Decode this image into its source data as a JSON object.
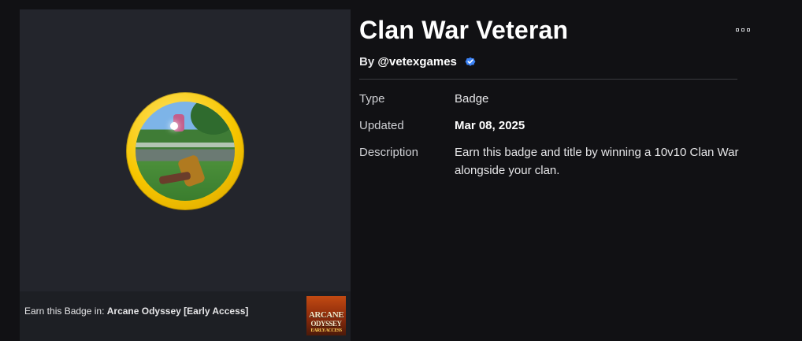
{
  "badge": {
    "title": "Clan War Veteran",
    "by_prefix": "By",
    "creator": "@vetexgames",
    "image_icon": "badge-artwork",
    "verified_icon": "verified-check-icon",
    "accent_color": "#f7c600",
    "verified_color": "#3b82f6"
  },
  "details": {
    "type_label": "Type",
    "type_value": "Badge",
    "updated_label": "Updated",
    "updated_value": "Mar 08, 2025",
    "description_label": "Description",
    "description_value": "Earn this badge and title by winning a 10v10 Clan War alongside your clan."
  },
  "earn": {
    "prefix": "Earn this Badge in:",
    "game_name": "Arcane Odyssey [Early Access]",
    "thumb_line1": "ARCANE",
    "thumb_line2": "ODYSSEY",
    "thumb_line3": "EARLY ACCESS"
  },
  "menu": {
    "icon": "more-options-icon"
  }
}
